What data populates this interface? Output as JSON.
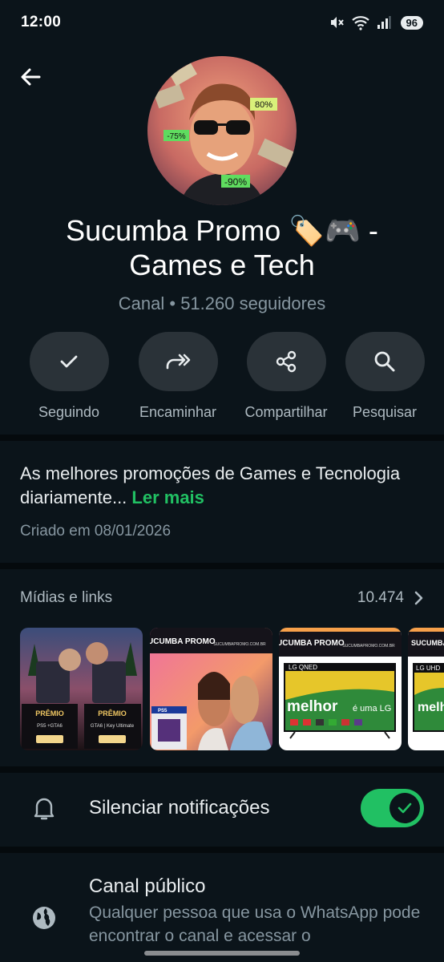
{
  "status_bar": {
    "time": "12:00",
    "battery": "96"
  },
  "channel": {
    "name_line1": "Sucumba Promo 🏷️🎮  -",
    "name_line2": "Games e Tech",
    "meta": "Canal • 51.260 seguidores"
  },
  "actions": [
    {
      "label": "Seguindo",
      "icon": "check-icon"
    },
    {
      "label": "Encaminhar",
      "icon": "forward-icon"
    },
    {
      "label": "Compartilhar",
      "icon": "share-icon"
    },
    {
      "label": "Pesquisar",
      "icon": "search-icon"
    }
  ],
  "description": {
    "text": "As melhores promoções de Games e Tecnologia diariamente... ",
    "read_more": "Ler mais",
    "created": "Criado em 08/01/2026"
  },
  "media": {
    "title": "Mídias e links",
    "count": "10.474",
    "thumbs": [
      {
        "brand": "",
        "heading1": "PRÊMIO",
        "heading2": "PRÊMIO",
        "line1": "PS5 +GTA6",
        "line2": "GTA6 | Key Ultimate"
      },
      {
        "brand": "SUCUMBA PROMO",
        "url": "SUCUMBAPROMO.COM.BR",
        "caption": "PS5"
      },
      {
        "brand": "SUCUMBA PROMO",
        "url": "SUCUMBAPROMO.COM.BR",
        "tv": "LG QNED",
        "slogan": "melhor",
        "slogan2": "é uma LG"
      },
      {
        "brand": "SUCUMBA PROMO",
        "tv": "LG UHD",
        "slogan": "melh"
      }
    ]
  },
  "mute": {
    "label": "Silenciar notificações",
    "enabled": true
  },
  "public_channel": {
    "title": "Canal público",
    "description": "Qualquer pessoa que usa o WhatsApp pode encontrar o canal e acessar o"
  },
  "colors": {
    "background": "#0b141a",
    "accent": "#21c063",
    "button_bg": "#2a3238",
    "muted_text": "#8696a0"
  }
}
